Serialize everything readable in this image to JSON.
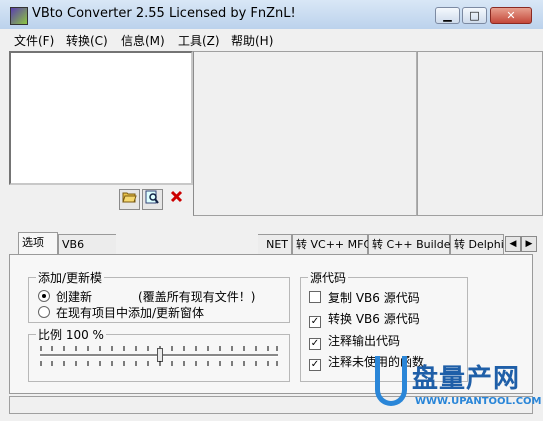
{
  "window": {
    "title": "VBto Converter 2.55   Licensed by FnZnL!",
    "minimize_glyph": "▁",
    "maximize_glyph": "□",
    "close_glyph": "✕"
  },
  "menu": [
    "文件(F)",
    "转换(C)",
    "信息(M)",
    "工具(Z)",
    "帮助(H)"
  ],
  "toolbar": {
    "open_icon": "open-folder-icon",
    "find_icon": "find-icon",
    "delete_icon": "delete-x-icon"
  },
  "tabs": {
    "options": "选项",
    "vb_partial": "VB6",
    "net_partial": "NET",
    "vcpp_mfc": "转 VC++ MFC",
    "cpp_builder": "转 C++ Builder",
    "delphi": "转 Delphi",
    "scroll_left": "◀",
    "scroll_right": "▶"
  },
  "add_update": {
    "label": "添加/更新模",
    "option_create": "创建新",
    "option_create_tail": "(覆盖所有现有文件！)",
    "option_in_existing": "在现有项目中添加/更新窗体"
  },
  "scale": {
    "label": "比例 100 %",
    "value_percent": 100
  },
  "source_code": {
    "label": "源代码",
    "items": [
      {
        "label": "复制 VB6 源代码",
        "checked": false
      },
      {
        "label": "转换 VB6 源代码",
        "checked": true
      },
      {
        "label": "注释输出代码",
        "checked": true
      },
      {
        "label": "注释未使用的函数",
        "checked": true
      }
    ]
  },
  "watermark": {
    "brand": "盘量产网",
    "url": "WWW.UPANTOOL.COM"
  },
  "colors": {
    "titlebar": "#bcd2ec",
    "watermark_blue": "#2a86d8"
  }
}
